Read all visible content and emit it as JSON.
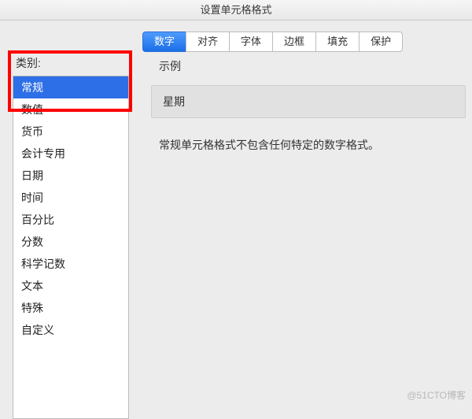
{
  "window": {
    "title": "设置单元格格式"
  },
  "tabs": {
    "items": [
      {
        "label": "数字",
        "active": true
      },
      {
        "label": "对齐",
        "active": false
      },
      {
        "label": "字体",
        "active": false
      },
      {
        "label": "边框",
        "active": false
      },
      {
        "label": "填充",
        "active": false
      },
      {
        "label": "保护",
        "active": false
      }
    ]
  },
  "categories": {
    "label": "类别:",
    "items": [
      {
        "label": "常规",
        "selected": true
      },
      {
        "label": "数值",
        "selected": false
      },
      {
        "label": "货币",
        "selected": false
      },
      {
        "label": "会计专用",
        "selected": false
      },
      {
        "label": "日期",
        "selected": false
      },
      {
        "label": "时间",
        "selected": false
      },
      {
        "label": "百分比",
        "selected": false
      },
      {
        "label": "分数",
        "selected": false
      },
      {
        "label": "科学记数",
        "selected": false
      },
      {
        "label": "文本",
        "selected": false
      },
      {
        "label": "特殊",
        "selected": false
      },
      {
        "label": "自定义",
        "selected": false
      }
    ]
  },
  "preview": {
    "example_label": "示例",
    "example_value": "星期",
    "description": "常规单元格格式不包含任何特定的数字格式。"
  },
  "watermark": "@51CTO博客"
}
